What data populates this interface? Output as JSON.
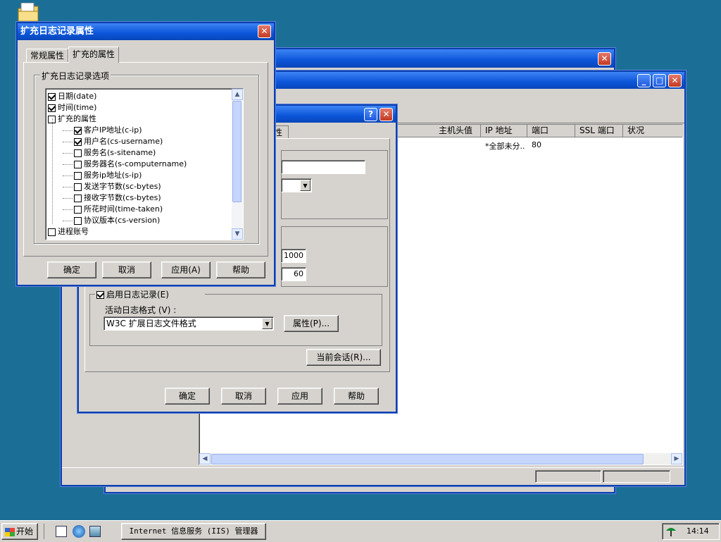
{
  "colors": {
    "desktop": "#1b6f97",
    "titlebar": "#0b55d9",
    "face": "#d6d3ce"
  },
  "desktop": {
    "icon_name": "folder-icon"
  },
  "back_window": {
    "columns": [
      "主机头值",
      "IP 地址",
      "端口",
      "SSL 端口",
      "状况"
    ],
    "row": {
      "ip": "*全部未分..",
      "port": "80"
    },
    "tab_fragment": "性"
  },
  "logging_dialog": {
    "enable_label": "启用日志记录(E)",
    "format_label": "活动日志格式 (V) :",
    "format_value": "W3C 扩展日志文件格式",
    "properties_button": "属性(P)...",
    "current_sessions_button": "当前会话(R)...",
    "value_1000": "1000",
    "value_60": "60",
    "ok": "确定",
    "cancel": "取消",
    "apply": "应用",
    "help": "帮助"
  },
  "ext_dialog": {
    "title": "扩充日志记录属性",
    "tabs": [
      "常规属性",
      "扩充的属性"
    ],
    "group_label": "扩充日志记录选项",
    "items": [
      {
        "label": "日期(date)",
        "checked": true,
        "level": 0
      },
      {
        "label": "时间(time)",
        "checked": true,
        "level": 0
      },
      {
        "label": "扩充的属性",
        "checked": false,
        "level": 0
      },
      {
        "label": "客户IP地址(c-ip)",
        "checked": true,
        "level": 1
      },
      {
        "label": "用户名(cs-username)",
        "checked": true,
        "level": 1
      },
      {
        "label": "服务名(s-sitename)",
        "checked": false,
        "level": 1
      },
      {
        "label": "服务器名(s-computername)",
        "checked": false,
        "level": 1
      },
      {
        "label": "服务ip地址(s-ip)",
        "checked": false,
        "level": 1
      },
      {
        "label": "发送字节数(sc-bytes)",
        "checked": false,
        "level": 1
      },
      {
        "label": "接收字节数(cs-bytes)",
        "checked": false,
        "level": 1
      },
      {
        "label": "所花时间(time-taken)",
        "checked": false,
        "level": 1
      },
      {
        "label": "协议版本(cs-version)",
        "checked": false,
        "level": 1
      },
      {
        "label": "进程账号",
        "checked": false,
        "level": 0
      }
    ],
    "ok": "确定",
    "cancel": "取消",
    "apply": "应用(A)",
    "help": "帮助"
  },
  "taskbar": {
    "start": "开始",
    "task": "Internet 信息服务 (IIS) 管理器",
    "clock": "14:14"
  }
}
